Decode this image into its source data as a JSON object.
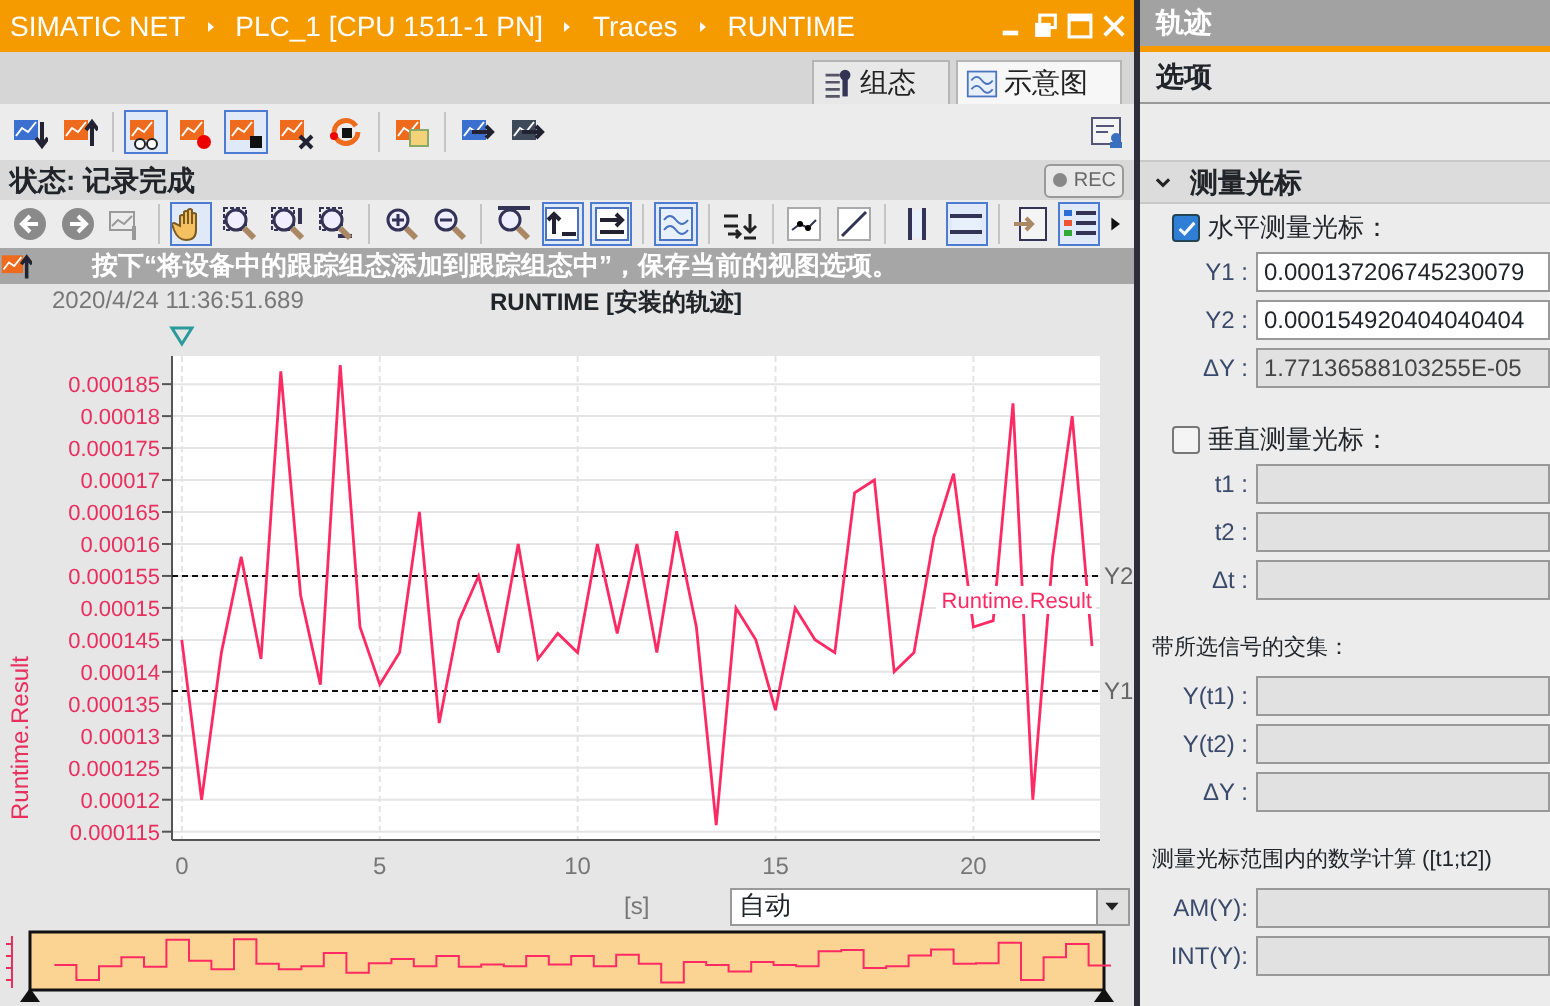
{
  "breadcrumb": [
    "SIMATIC NET",
    "PLC_1 [CPU 1511-1 PN]",
    "Traces",
    "RUNTIME"
  ],
  "view_tabs": [
    {
      "label": "组态",
      "selected": false
    },
    {
      "label": "示意图",
      "selected": true
    }
  ],
  "toolbar_top": [
    {
      "selected": false
    },
    {
      "selected": false
    },
    {
      "selected": true
    },
    {
      "selected": false
    },
    {
      "selected": true
    },
    {
      "selected": false
    },
    {
      "selected": false
    },
    {
      "selected": false
    },
    {
      "selected": false
    },
    {
      "selected": false
    }
  ],
  "status": {
    "text": "状态: 记录完成",
    "rec": "REC"
  },
  "toolbar_chart": [
    {
      "selected": false
    },
    {
      "selected": false
    },
    {
      "selected": false
    },
    {
      "selected": true
    },
    {
      "selected": false
    },
    {
      "selected": false
    },
    {
      "selected": false
    },
    {
      "selected": false
    },
    {
      "selected": false
    },
    {
      "selected": false
    },
    {
      "selected": true
    },
    {
      "selected": true
    },
    {
      "selected": true
    },
    {
      "selected": false
    },
    {
      "selected": false
    },
    {
      "selected": false
    },
    {
      "selected": false
    },
    {
      "selected": true
    },
    {
      "selected": false
    },
    {
      "selected": true
    }
  ],
  "hint": "按下“将设备中的跟踪组态添加到跟踪组态中”，保存当前的视图选项。",
  "timestamp": "2020/4/24 11:36:51.689",
  "chart_data": {
    "type": "line",
    "title": "RUNTIME [安装的轨迹]",
    "xlabel": "[s]",
    "ylabel": "Runtime.Result",
    "x": [
      0,
      0.5,
      1,
      1.5,
      2,
      2.5,
      3,
      3.5,
      4,
      4.5,
      5,
      5.5,
      6,
      6.5,
      7,
      7.5,
      8,
      8.5,
      9,
      9.5,
      10,
      10.5,
      11,
      11.5,
      12,
      12.5,
      13,
      13.5,
      14,
      14.5,
      15,
      15.5,
      16,
      16.5,
      17,
      17.5,
      18,
      18.5,
      19,
      19.5,
      20,
      20.5,
      21,
      21.5,
      22,
      22.5,
      23
    ],
    "series": [
      {
        "name": "Runtime.Result",
        "color": "#ff2a63",
        "values": [
          0.000145,
          0.00012,
          0.000143,
          0.000158,
          0.000142,
          0.000187,
          0.000152,
          0.000138,
          0.000188,
          0.000147,
          0.000138,
          0.000143,
          0.000165,
          0.000132,
          0.000148,
          0.000155,
          0.000143,
          0.00016,
          0.000142,
          0.000146,
          0.000143,
          0.00016,
          0.000146,
          0.00016,
          0.000143,
          0.000162,
          0.000147,
          0.000116,
          0.00015,
          0.000145,
          0.000134,
          0.00015,
          0.000145,
          0.000143,
          0.000168,
          0.00017,
          0.00014,
          0.000143,
          0.000161,
          0.000171,
          0.000147,
          0.000148,
          0.000182,
          0.00012,
          0.000158,
          0.00018,
          0.000144
        ]
      }
    ],
    "xlim": [
      -0.25,
      23.2
    ],
    "ylim": [
      0.0001137,
      0.0001894
    ],
    "xticks": [
      0,
      5,
      10,
      15,
      20
    ],
    "yticks": [
      0.000115,
      0.00012,
      0.000125,
      0.00013,
      0.000135,
      0.00014,
      0.000145,
      0.00015,
      0.000155,
      0.00016,
      0.000165,
      0.00017,
      0.000175,
      0.00018,
      0.000185
    ],
    "grid": true,
    "ref_lines": [
      {
        "axis": "y",
        "value": 0.000155,
        "label": "Y2"
      },
      {
        "axis": "y",
        "value": 0.000137,
        "label": "Y1"
      }
    ]
  },
  "time_base": {
    "value": "自动"
  },
  "panel": {
    "title": "轨迹",
    "tab": "选项",
    "section": {
      "title": "测量光标",
      "expanded": true
    },
    "groups": [
      {
        "kind": "check",
        "label": "水平测量光标：",
        "checked": true,
        "fields": [
          {
            "label": "Y1 :",
            "value": "0.000137206745230079",
            "disabled": false
          },
          {
            "label": "Y2 :",
            "value": "0.000154920404040404",
            "disabled": false
          },
          {
            "label": "ΔY :",
            "value": "1.77136588103255E-05",
            "disabled": true
          }
        ]
      },
      {
        "kind": "check",
        "label": "垂直测量光标：",
        "checked": false,
        "fields": [
          {
            "label": "t1 :",
            "disabled": true
          },
          {
            "label": "t2 :",
            "disabled": true
          },
          {
            "label": "Δt :",
            "disabled": true
          }
        ]
      },
      {
        "kind": "heading",
        "label": "带所选信号的交集：",
        "fields": [
          {
            "label": "Y(t1) :",
            "disabled": true
          },
          {
            "label": "Y(t2) :",
            "disabled": true
          },
          {
            "label": "ΔY :",
            "disabled": true
          }
        ]
      },
      {
        "kind": "heading",
        "label": "测量光标范围内的数学计算 ([t1;t2])",
        "fields": [
          {
            "label": "AM(Y):",
            "disabled": true
          },
          {
            "label": "INT(Y):",
            "disabled": true
          }
        ]
      }
    ]
  }
}
